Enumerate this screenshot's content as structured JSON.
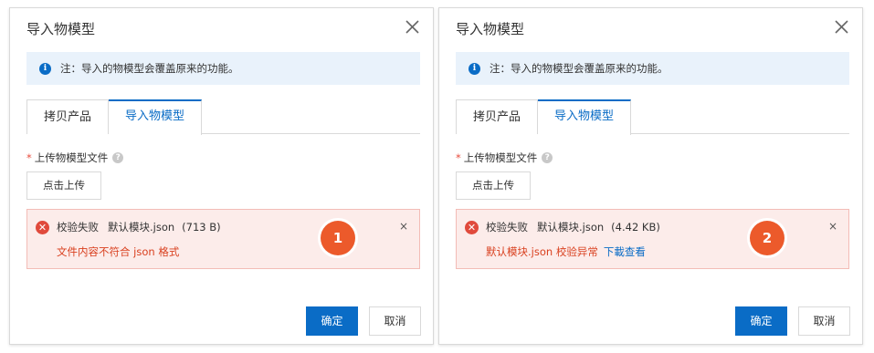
{
  "dialogs": [
    {
      "title": "导入物模型",
      "notice": "注：导入的物模型会覆盖原来的功能。",
      "tabs": [
        "拷贝产品",
        "导入物模型"
      ],
      "upload_label": "上传物模型文件",
      "required_mark": "*",
      "upload_button": "点击上传",
      "error": {
        "status": "校验失败",
        "file_name": "默认模块.json",
        "file_size": "(713 B)",
        "message": "文件内容不符合 json 格式",
        "link": "",
        "close": "×"
      },
      "badge": "1",
      "ok_label": "确定",
      "cancel_label": "取消"
    },
    {
      "title": "导入物模型",
      "notice": "注：导入的物模型会覆盖原来的功能。",
      "tabs": [
        "拷贝产品",
        "导入物模型"
      ],
      "upload_label": "上传物模型文件",
      "required_mark": "*",
      "upload_button": "点击上传",
      "error": {
        "status": "校验失败",
        "file_name": "默认模块.json",
        "file_size": "(4.42 KB)",
        "message": "默认模块.json 校验异常",
        "link": "下載查看",
        "close": "×"
      },
      "badge": "2",
      "ok_label": "确定",
      "cancel_label": "取消"
    }
  ],
  "icons": {
    "close": "close-icon",
    "info": "info-icon",
    "help": "help-icon",
    "error": "error-icon"
  },
  "colors": {
    "primary": "#0a6cc6",
    "error_bg": "#fcecea",
    "error_text": "#d9401f",
    "badge": "#ec5a2b",
    "notice_bg": "#e9f2fb"
  }
}
